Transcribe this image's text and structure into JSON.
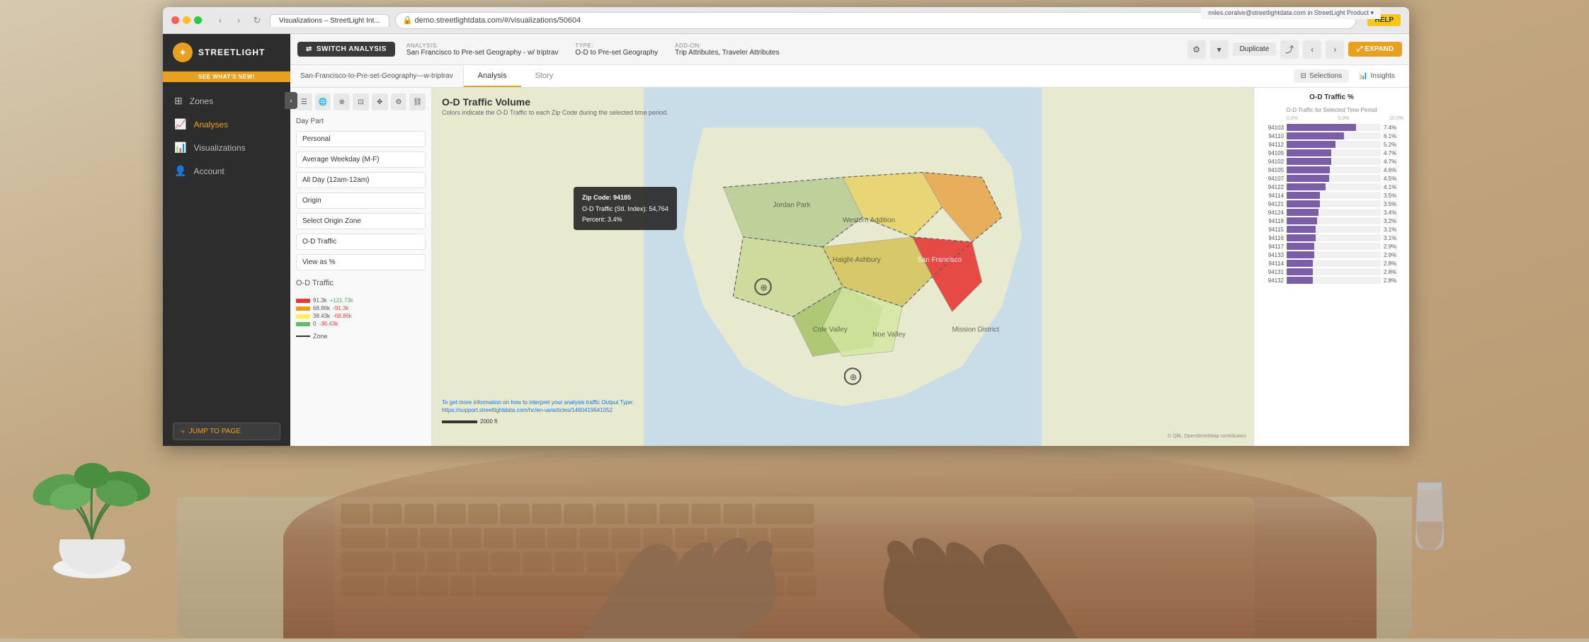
{
  "browser": {
    "url": "demo.streetlightdata.com/#/visualizations/50604",
    "tab_label": "Visualizations – StreetLight Int...",
    "help_label": "HELP"
  },
  "user_bar": {
    "text": "miles.ceralve@streetlightdata.com in StreetLight Product ▾"
  },
  "brand": {
    "name": "STREETLIGHT"
  },
  "whats_new": "SEE WHAT'S NEW!",
  "sidebar": {
    "items": [
      {
        "id": "zones",
        "label": "Zones",
        "icon": "⊞"
      },
      {
        "id": "analyses",
        "label": "Analyses",
        "icon": "📈"
      },
      {
        "id": "visualizations",
        "label": "Visualizations",
        "icon": "📊"
      },
      {
        "id": "account",
        "label": "Account",
        "icon": "👤"
      }
    ],
    "jump_label": "JUMP TO PAGE"
  },
  "topbar": {
    "switch_analysis_label": "SWITCH ANALYSIS",
    "analysis_label": "ANALYSIS:",
    "analysis_name": "San Francisco to Pre-set Geography - w/ triptrav",
    "type_label": "TYPE:",
    "type_value": "O-D to Pre-set Geography",
    "addon_label": "ADD-ON:",
    "addon_value": "Trip Attributes, Traveler Attributes",
    "duplicate_label": "Duplicate",
    "expand_label": "EXPAND"
  },
  "tabs": {
    "breadcrumb": "San-Francisco-to-Pre-set-Geography---w-triptrav",
    "analysis_tab": "Analysis",
    "story_tab": "Story",
    "selections_label": "Selections",
    "insights_label": "Insights"
  },
  "filter_panel": {
    "filter1_label": "Personal",
    "filter2_label": "Average Weekday (M-F)",
    "filter3_label": "All Day (12am-12am)",
    "filter4_label": "Origin",
    "filter5_label": "Select Origin Zone",
    "filter6_label": "O-D Traffic",
    "filter7_label": "View as %",
    "chart_title": "O-D Traffic",
    "metrics": [
      {
        "label": "91.3k",
        "change": "+121.73k",
        "color": "#e53935"
      },
      {
        "label": "68.86k",
        "change": "-91.3k",
        "color": "#e8a020"
      },
      {
        "label": "38.43k",
        "change": "-68.86k",
        "color": "#ffee58"
      },
      {
        "label": "0",
        "change": "-30.43k",
        "color": "#66bb6a"
      }
    ],
    "zone_legend": "Zone"
  },
  "map": {
    "title": "O-D Traffic Volume",
    "subtitle": "Colors indicate the O-D Traffic to each Zip Code during the selected time period.",
    "tooltip": {
      "zip_label": "Zip Code:",
      "zip_value": "94185",
      "traffic_label": "O-D Traffic (Stl. Index):",
      "traffic_value": "54,764",
      "percent_label": "Percent:",
      "percent_value": "3.4%"
    },
    "scale_label": "2000 ft",
    "attribution": "© Qlik, OpenStreetMap contributors",
    "link_text": "To get more information on how to interpret your analysis traffic Output Type: https://support.streetlightdata.com/hc/en-us/articles/1460419641052"
  },
  "chart_panel": {
    "title": "O-D Traffic %",
    "subtitle_left": "0.0%",
    "subtitle_mid": "5.0%",
    "subtitle_right": "10.0%",
    "highlight_label": "O-D Traffic for Selected Time Period",
    "bars": [
      {
        "label": "94103",
        "value": 7.4,
        "display": "7.4%"
      },
      {
        "label": "94110",
        "value": 6.1,
        "display": "6.1%"
      },
      {
        "label": "94112",
        "value": 5.2,
        "display": "5.2%"
      },
      {
        "label": "94109",
        "value": 4.7,
        "display": "4.7%"
      },
      {
        "label": "94102",
        "value": 4.7,
        "display": "4.7%"
      },
      {
        "label": "94105",
        "value": 4.6,
        "display": "4.6%"
      },
      {
        "label": "94107",
        "value": 4.5,
        "display": "4.5%"
      },
      {
        "label": "94122",
        "value": 4.1,
        "display": "4.1%"
      },
      {
        "label": "94114",
        "value": 3.5,
        "display": "3.5%"
      },
      {
        "label": "94121",
        "value": 3.5,
        "display": "3.5%"
      },
      {
        "label": "94124",
        "value": 3.4,
        "display": "3.4%"
      },
      {
        "label": "94118",
        "value": 3.2,
        "display": "3.2%"
      },
      {
        "label": "94115",
        "value": 3.1,
        "display": "3.1%"
      },
      {
        "label": "94116",
        "value": 3.1,
        "display": "3.1%"
      },
      {
        "label": "94117",
        "value": 2.9,
        "display": "2.9%"
      },
      {
        "label": "94133",
        "value": 2.9,
        "display": "2.9%"
      },
      {
        "label": "94114",
        "value": 2.8,
        "display": "2.8%"
      },
      {
        "label": "94131",
        "value": 2.8,
        "display": "2.8%"
      },
      {
        "label": "94132",
        "value": 2.8,
        "display": "2.8%"
      }
    ],
    "max_value": 10.0
  }
}
